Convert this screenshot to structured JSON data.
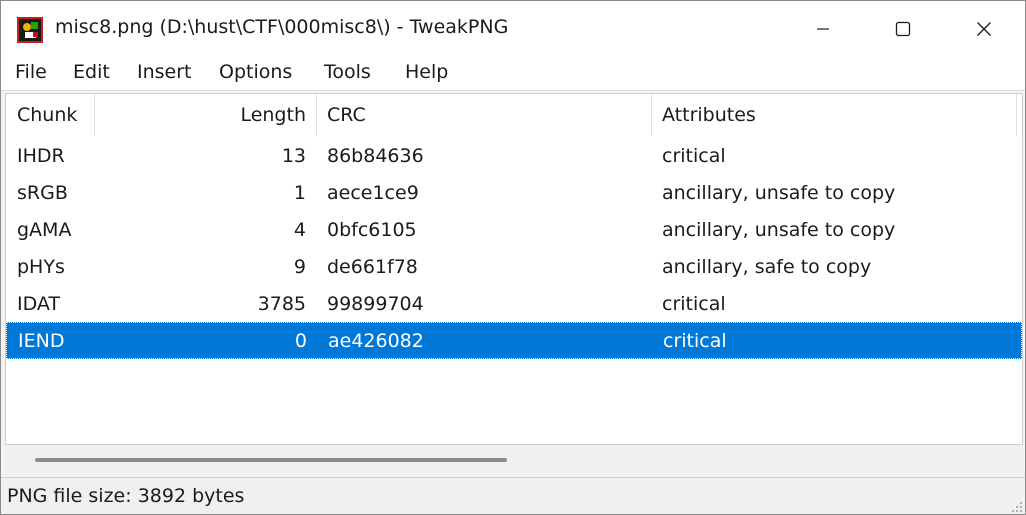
{
  "window": {
    "title": "misc8.png (D:\\hust\\CTF\\000misc8\\) - TweakPNG",
    "icon": "tweakpng-app-icon",
    "controls": [
      "minimize-icon",
      "maximize-icon",
      "close-icon"
    ]
  },
  "menu": [
    "File",
    "Edit",
    "Insert",
    "Options",
    "Tools",
    "Help"
  ],
  "table": {
    "columns": [
      "Chunk",
      "Length",
      "CRC",
      "Attributes"
    ],
    "rows": [
      {
        "chunk": "IHDR",
        "length": "13",
        "crc": "86b84636",
        "attributes": "critical"
      },
      {
        "chunk": "sRGB",
        "length": "1",
        "crc": "aece1ce9",
        "attributes": "ancillary, unsafe to copy"
      },
      {
        "chunk": "gAMA",
        "length": "4",
        "crc": "0bfc6105",
        "attributes": "ancillary, unsafe to copy"
      },
      {
        "chunk": "pHYs",
        "length": "9",
        "crc": "de661f78",
        "attributes": "ancillary, safe to copy"
      },
      {
        "chunk": "IDAT",
        "length": "3785",
        "crc": "99899704",
        "attributes": "critical"
      },
      {
        "chunk": "IEND",
        "length": "0",
        "crc": "ae426082",
        "attributes": "critical",
        "selected": true
      }
    ]
  },
  "status": {
    "text": "PNG file size: 3892 bytes"
  },
  "colors": {
    "selection": "#0078d7",
    "background": "#f3f3f3"
  }
}
